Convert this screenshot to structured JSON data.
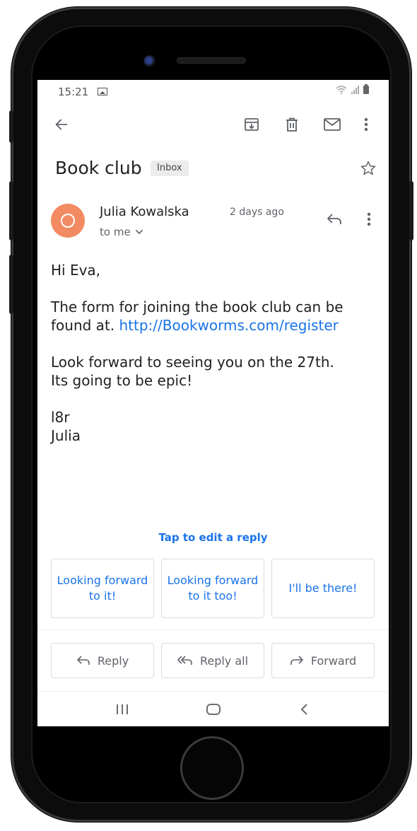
{
  "status_bar": {
    "time": "15:21"
  },
  "email": {
    "subject": "Book club",
    "label": "Inbox",
    "sender": "Julia Kowalska",
    "time": "2 days ago",
    "recipient": "to me",
    "body": {
      "greeting": "Hi Eva,",
      "para1_text": "The form for joining the book club can be found at.",
      "link": "http://Bookworms.com/register",
      "para2_line1": "Look forward to seeing you on the 27th.",
      "para2_line2": "Its going to be epic!",
      "signoff_line1": "l8r",
      "signoff_line2": "Julia"
    }
  },
  "smart_replies": {
    "prompt": "Tap to edit a reply",
    "options": [
      "Looking forward to it!",
      "Looking forward to it too!",
      "I'll be there!"
    ]
  },
  "actions": {
    "reply": "Reply",
    "reply_all": "Reply all",
    "forward": "Forward"
  },
  "colors": {
    "accent": "#1a73e8",
    "avatar": "#f28b62"
  }
}
